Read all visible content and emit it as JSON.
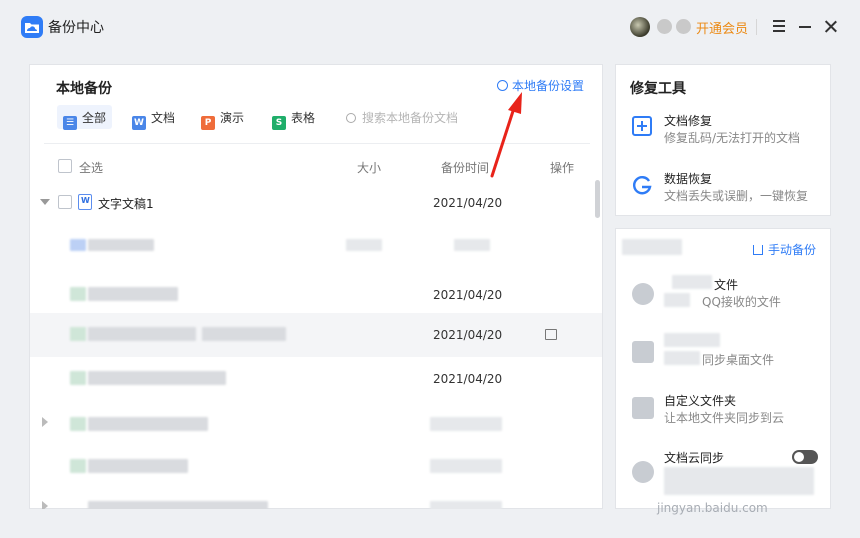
{
  "app": {
    "title": "备份中心"
  },
  "titlebar": {
    "vip_label": "开通会员"
  },
  "local_backup": {
    "title": "本地备份",
    "settings_label": "本地备份设置",
    "filters": [
      {
        "label": "全部",
        "badge": "☰",
        "color": "#4a86e8"
      },
      {
        "label": "文档",
        "badge": "W",
        "color": "#4a86e8"
      },
      {
        "label": "演示",
        "badge": "P",
        "color": "#ef6c3a"
      },
      {
        "label": "表格",
        "badge": "S",
        "color": "#1fae6a"
      }
    ],
    "search_placeholder": "搜索本地备份文档",
    "columns": {
      "select_all": "全选",
      "size": "大小",
      "time": "备份时间",
      "action": "操作"
    },
    "rows": [
      {
        "name": "文字文稿1",
        "date": "2021/04/20"
      },
      {
        "name": "",
        "date": ""
      },
      {
        "name": "",
        "date": "2021/04/20"
      },
      {
        "name": "",
        "date": "2021/04/20"
      },
      {
        "name": "",
        "date": "2021/04/20"
      }
    ]
  },
  "repair_tools": {
    "title": "修复工具",
    "items": [
      {
        "title": "文档修复",
        "desc": "修复乱码/无法打开的文档"
      },
      {
        "title": "数据恢复",
        "desc": "文档丢失或误删，一键恢复"
      }
    ]
  },
  "cloud_backup": {
    "manual_label": "手动备份",
    "items": [
      {
        "title": "文件",
        "desc": "QQ接收的文件"
      },
      {
        "title": "",
        "desc": "同步桌面文件"
      },
      {
        "title": "自定义文件夹",
        "desc": "让本地文件夹同步到云"
      },
      {
        "title": "文档云同步",
        "desc": ""
      }
    ]
  },
  "watermark": {
    "url": "jingyan.baidu.com"
  },
  "colors": {
    "accent": "#2f7cf6",
    "vip": "#ec8a14",
    "arrow": "#e8231a"
  }
}
